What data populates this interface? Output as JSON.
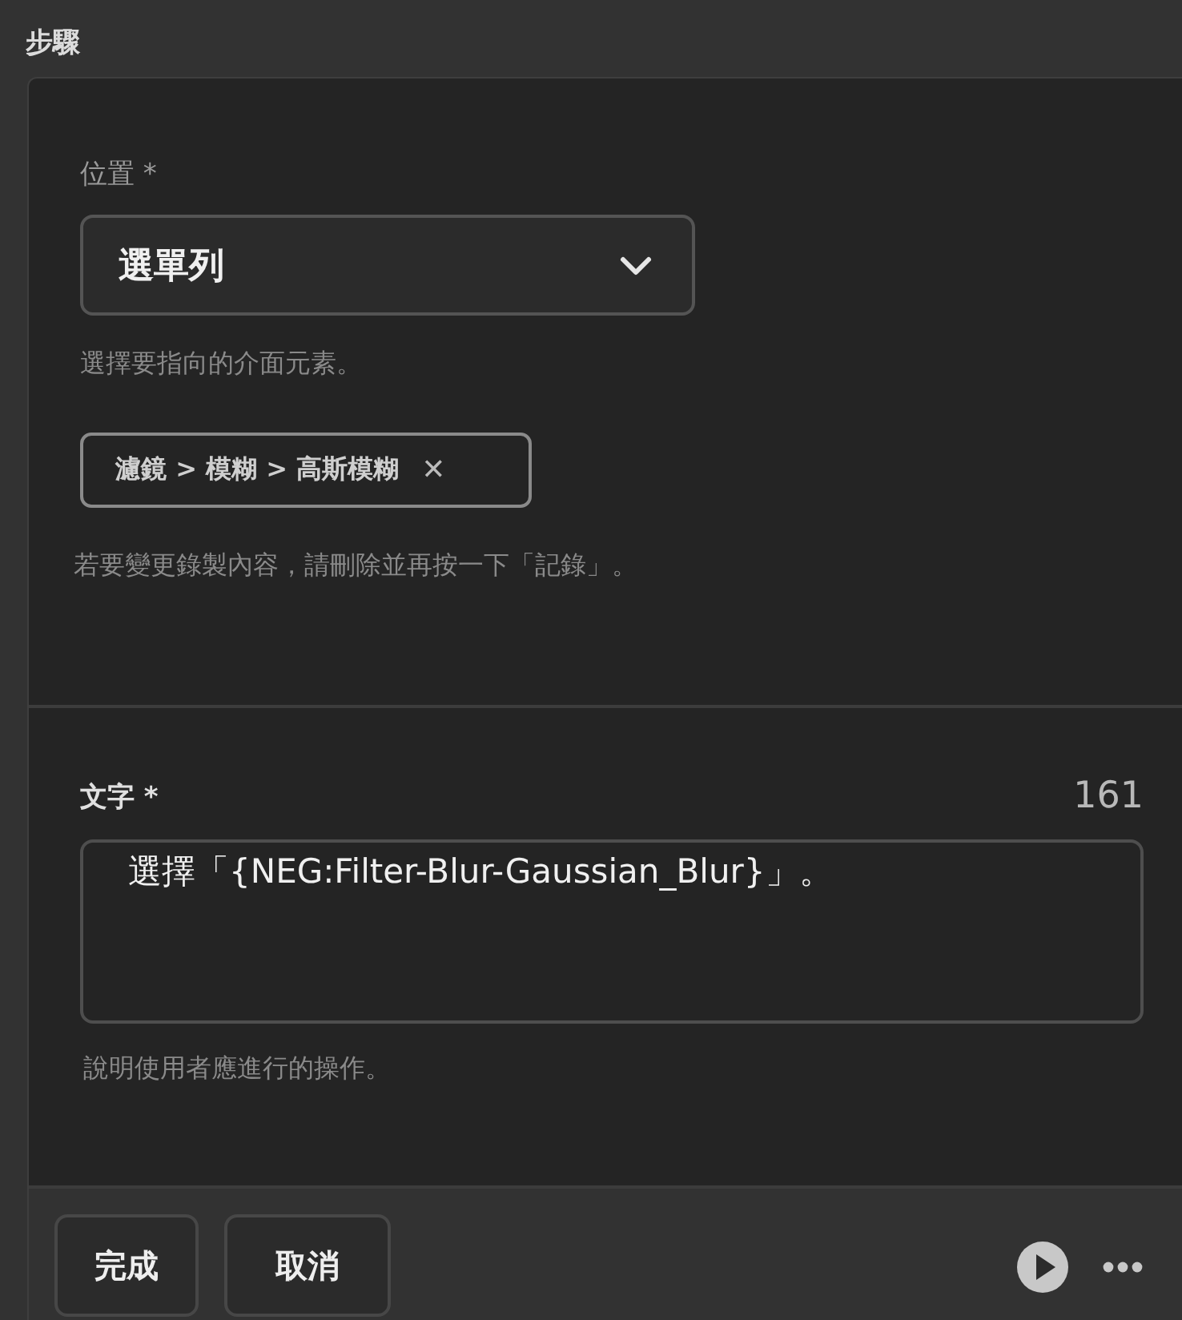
{
  "header": {
    "title": "步驟"
  },
  "location": {
    "label": "位置 *",
    "value": "選單列",
    "help": "選擇要指向的介面元素。"
  },
  "recorded_tag": {
    "label": "濾鏡 > 模糊 > 高斯模糊",
    "close": "✕",
    "help": "若要變更錄製內容，請刪除並再按一下「記錄」。"
  },
  "text": {
    "label": "文字 *",
    "counter": "161",
    "value": "選擇「{NEG:Filter-Blur-Gaussian_Blur}」。",
    "help": "說明使用者應進行的操作。"
  },
  "footer": {
    "buttons": [
      "完成",
      "取消"
    ]
  }
}
